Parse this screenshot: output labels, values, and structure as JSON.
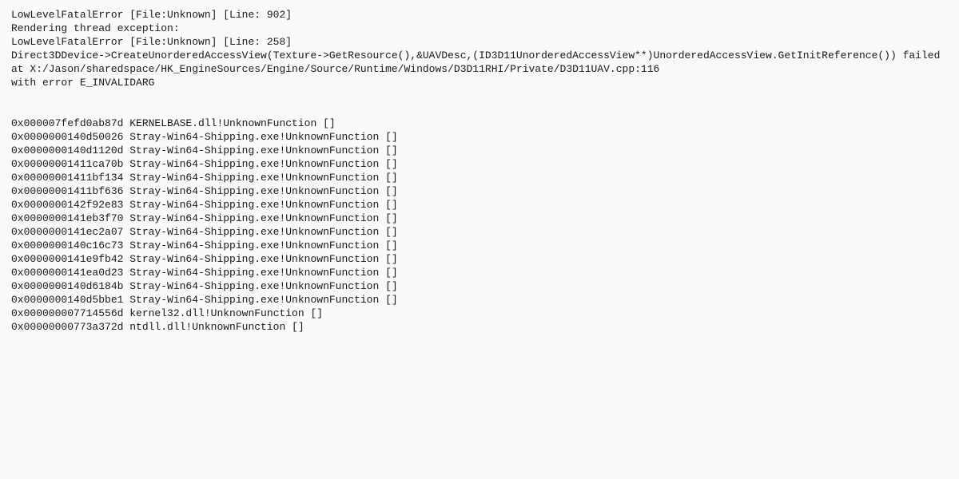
{
  "header": {
    "line1": "LowLevelFatalError [File:Unknown] [Line: 902]",
    "line2": "Rendering thread exception:",
    "line3": "LowLevelFatalError [File:Unknown] [Line: 258]",
    "line4": "Direct3DDevice->CreateUnorderedAccessView(Texture->GetResource(),&UAVDesc,(ID3D11UnorderedAccessView**)UnorderedAccessView.GetInitReference()) failed",
    "line5": " at X:/Jason/sharedspace/HK_EngineSources/Engine/Source/Runtime/Windows/D3D11RHI/Private/D3D11UAV.cpp:116",
    "line6": " with error E_INVALIDARG"
  },
  "stack": [
    "0x000007fefd0ab87d KERNELBASE.dll!UnknownFunction []",
    "0x0000000140d50026 Stray-Win64-Shipping.exe!UnknownFunction []",
    "0x0000000140d1120d Stray-Win64-Shipping.exe!UnknownFunction []",
    "0x00000001411ca70b Stray-Win64-Shipping.exe!UnknownFunction []",
    "0x00000001411bf134 Stray-Win64-Shipping.exe!UnknownFunction []",
    "0x00000001411bf636 Stray-Win64-Shipping.exe!UnknownFunction []",
    "0x0000000142f92e83 Stray-Win64-Shipping.exe!UnknownFunction []",
    "0x0000000141eb3f70 Stray-Win64-Shipping.exe!UnknownFunction []",
    "0x0000000141ec2a07 Stray-Win64-Shipping.exe!UnknownFunction []",
    "0x0000000140c16c73 Stray-Win64-Shipping.exe!UnknownFunction []",
    "0x0000000141e9fb42 Stray-Win64-Shipping.exe!UnknownFunction []",
    "0x0000000141ea0d23 Stray-Win64-Shipping.exe!UnknownFunction []",
    "0x0000000140d6184b Stray-Win64-Shipping.exe!UnknownFunction []",
    "0x0000000140d5bbe1 Stray-Win64-Shipping.exe!UnknownFunction []",
    "0x000000007714556d kernel32.dll!UnknownFunction []",
    "0x00000000773a372d ntdll.dll!UnknownFunction []"
  ]
}
